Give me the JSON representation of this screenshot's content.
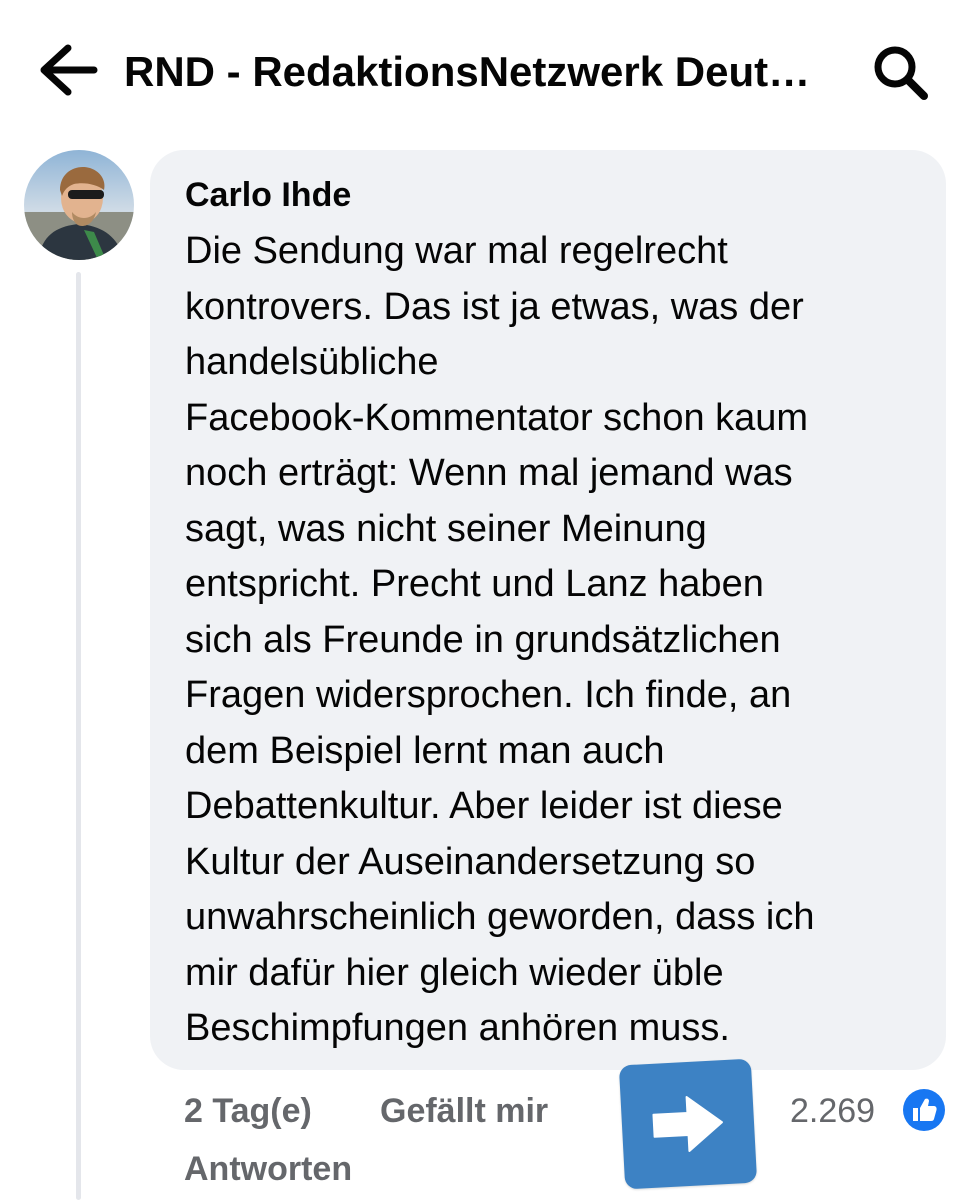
{
  "header": {
    "title": "RND - RedaktionsNetzwerk Deut…",
    "back_icon": "arrow-left-icon",
    "search_icon": "search-icon"
  },
  "comment": {
    "author": "Carlo Ihde",
    "text": "Die Sendung war mal regelrecht\nkontrovers. Das ist ja etwas, was der\nhandelsübliche\nFacebook-Kommentator schon kaum\nnoch erträgt: Wenn mal jemand was\nsagt, was nicht seiner Meinung\nentspricht. Precht und Lanz haben\nsich als Freunde in grundsätzlichen\nFragen widersprochen. Ich finde, an\ndem Beispiel lernt man auch\nDebattenkultur. Aber leider ist diese\nKultur der Auseinandersetzung so\nunwahrscheinlich geworden, dass ich\nmir dafür hier gleich wieder üble\nBeschimpfungen anhören muss.",
    "time": "2 Tag(e)",
    "like_label": "Gefällt mir",
    "reply_label": "Antworten",
    "reaction_count": "2.269",
    "reaction_icon": "like-thumb-icon",
    "share_icon": "share-arrow-icon"
  },
  "colors": {
    "bubble": "#f0f2f5",
    "meta_text": "#65676b",
    "facebook_blue": "#1877f2",
    "share_overlay": "#3d82c4"
  }
}
